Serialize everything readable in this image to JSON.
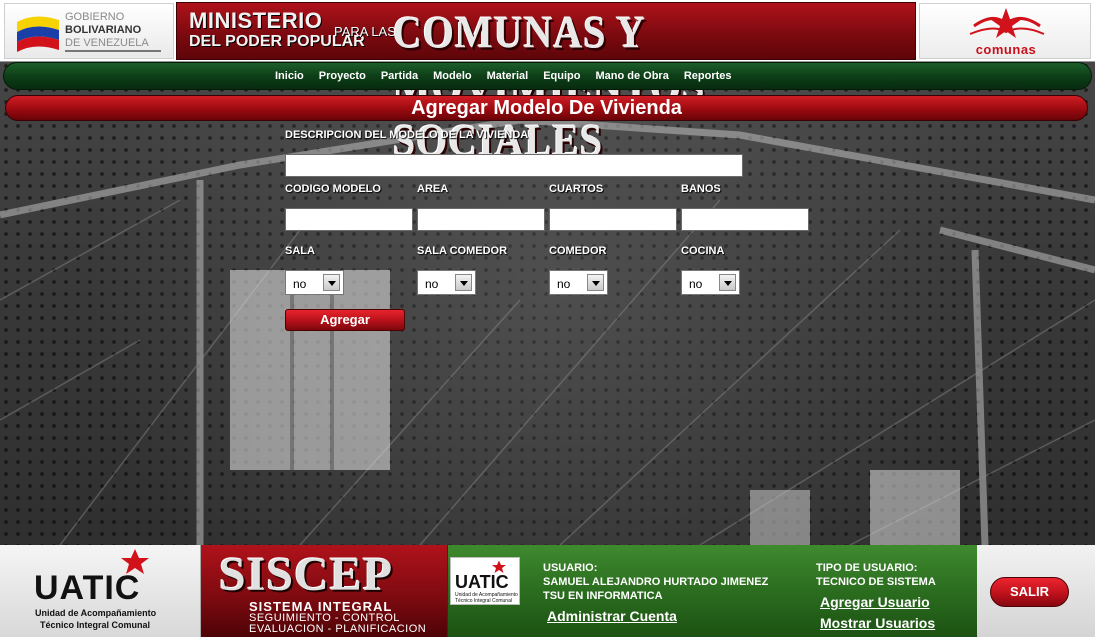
{
  "header": {
    "gob_line1": "GOBIERNO",
    "gob_line2": "BOLIVARIANO",
    "gob_line3": "DE VENEZUELA",
    "ministerio": "MINISTERIO",
    "poder_popular": "DEL PODER POPULAR",
    "para_las": "PARA LAS",
    "comunas_title": "COMUNAS Y MOVIMIENTOS SOCIALES",
    "right_logo_text": "comunas"
  },
  "nav": {
    "items": [
      "Inicio",
      "Proyecto",
      "Partida",
      "Modelo",
      "Material",
      "Equipo",
      "Mano de Obra",
      "Reportes"
    ]
  },
  "page": {
    "title": "Agregar Modelo De Vivienda"
  },
  "form": {
    "descripcion_label": "DESCRIPCION DEL MODELO DE LA VIVIENDA",
    "descripcion_value": "",
    "codigo_label": "CODIGO MODELO",
    "area_label": "AREA",
    "cuartos_label": "CUARTOS",
    "banos_label": "BANOS",
    "codigo_value": "",
    "area_value": "",
    "cuartos_value": "",
    "banos_value": "",
    "sala_label": "SALA",
    "sala_comedor_label": "SALA COMEDOR",
    "comedor_label": "COMEDOR",
    "cocina_label": "COCINA",
    "sala_value": "no",
    "sala_comedor_value": "no",
    "comedor_value": "no",
    "cocina_value": "no",
    "submit_label": "Agregar"
  },
  "footer": {
    "uatic_big": "UATIC",
    "uatic_sub1": "Unidad de Acompañamiento",
    "uatic_sub2": "Técnico Integral Comunal",
    "siscep_name": "SISCEP",
    "siscep_sub1": "SISTEMA INTEGRAL",
    "siscep_sub2": "SEGUIMIENTO - CONTROL",
    "siscep_sub3": "EVALUACION - PLANIFICACION",
    "mini_logo_text": "UATIC",
    "mini_logo_sub": "Unidad de Acompañamiento Técnico Integral Comunal",
    "usuario_label": "USUARIO:",
    "usuario_name": "SAMUEL ALEJANDRO HURTADO JIMENEZ",
    "usuario_title": "TSU EN INFORMATICA",
    "tipo_label": "TIPO DE USUARIO:",
    "tipo_value": "TECNICO DE SISTEMA",
    "link_admin": "Administrar Cuenta",
    "link_agregar": "Agregar Usuario",
    "link_mostrar": "Mostrar Usuarios",
    "salir_label": "SALIR"
  },
  "colors": {
    "brand_red": "#b0121a",
    "nav_green": "#0e3f18",
    "panel_green": "#2b6d1f"
  }
}
